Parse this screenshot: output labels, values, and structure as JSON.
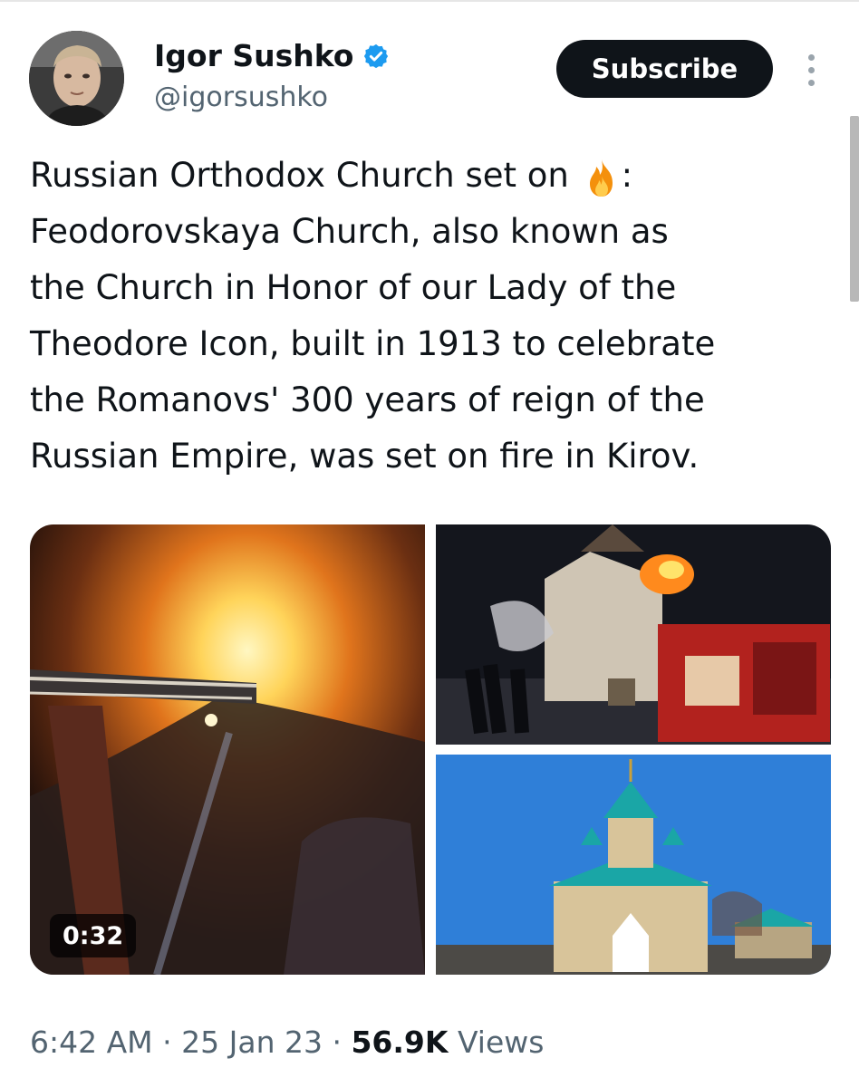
{
  "author": {
    "name": "Igor Sushko",
    "handle": "@igorsushko",
    "verified": true
  },
  "actions": {
    "subscribe_label": "Subscribe",
    "more_icon": "more-vertical-icon"
  },
  "tweet": {
    "line1_before_emoji": "Russian Orthodox Church set on ",
    "emoji": "fire-emoji",
    "line1_after_emoji": ":",
    "body": "Feodorovskaya Church, also known as\nthe Church in Honor of our Lady of the\nTheodore Icon, built in 1913 to celebrate\nthe Romanovs' 300 years of reign of the\nRussian Empire, was set on fire in Kirov."
  },
  "media": {
    "video_duration": "0:32",
    "images": [
      "video-burning-church-ladder",
      "photo-church-fire-firetruck",
      "photo-church-blue-sky"
    ]
  },
  "meta": {
    "time": "6:42 AM",
    "separator": " · ",
    "date": "25 Jan 23",
    "views_count": "56.9K",
    "views_label": " Views"
  },
  "colors": {
    "text": "#0f1419",
    "secondary": "#536471",
    "verified_blue": "#1d9bf0",
    "button_bg": "#0f1419"
  }
}
